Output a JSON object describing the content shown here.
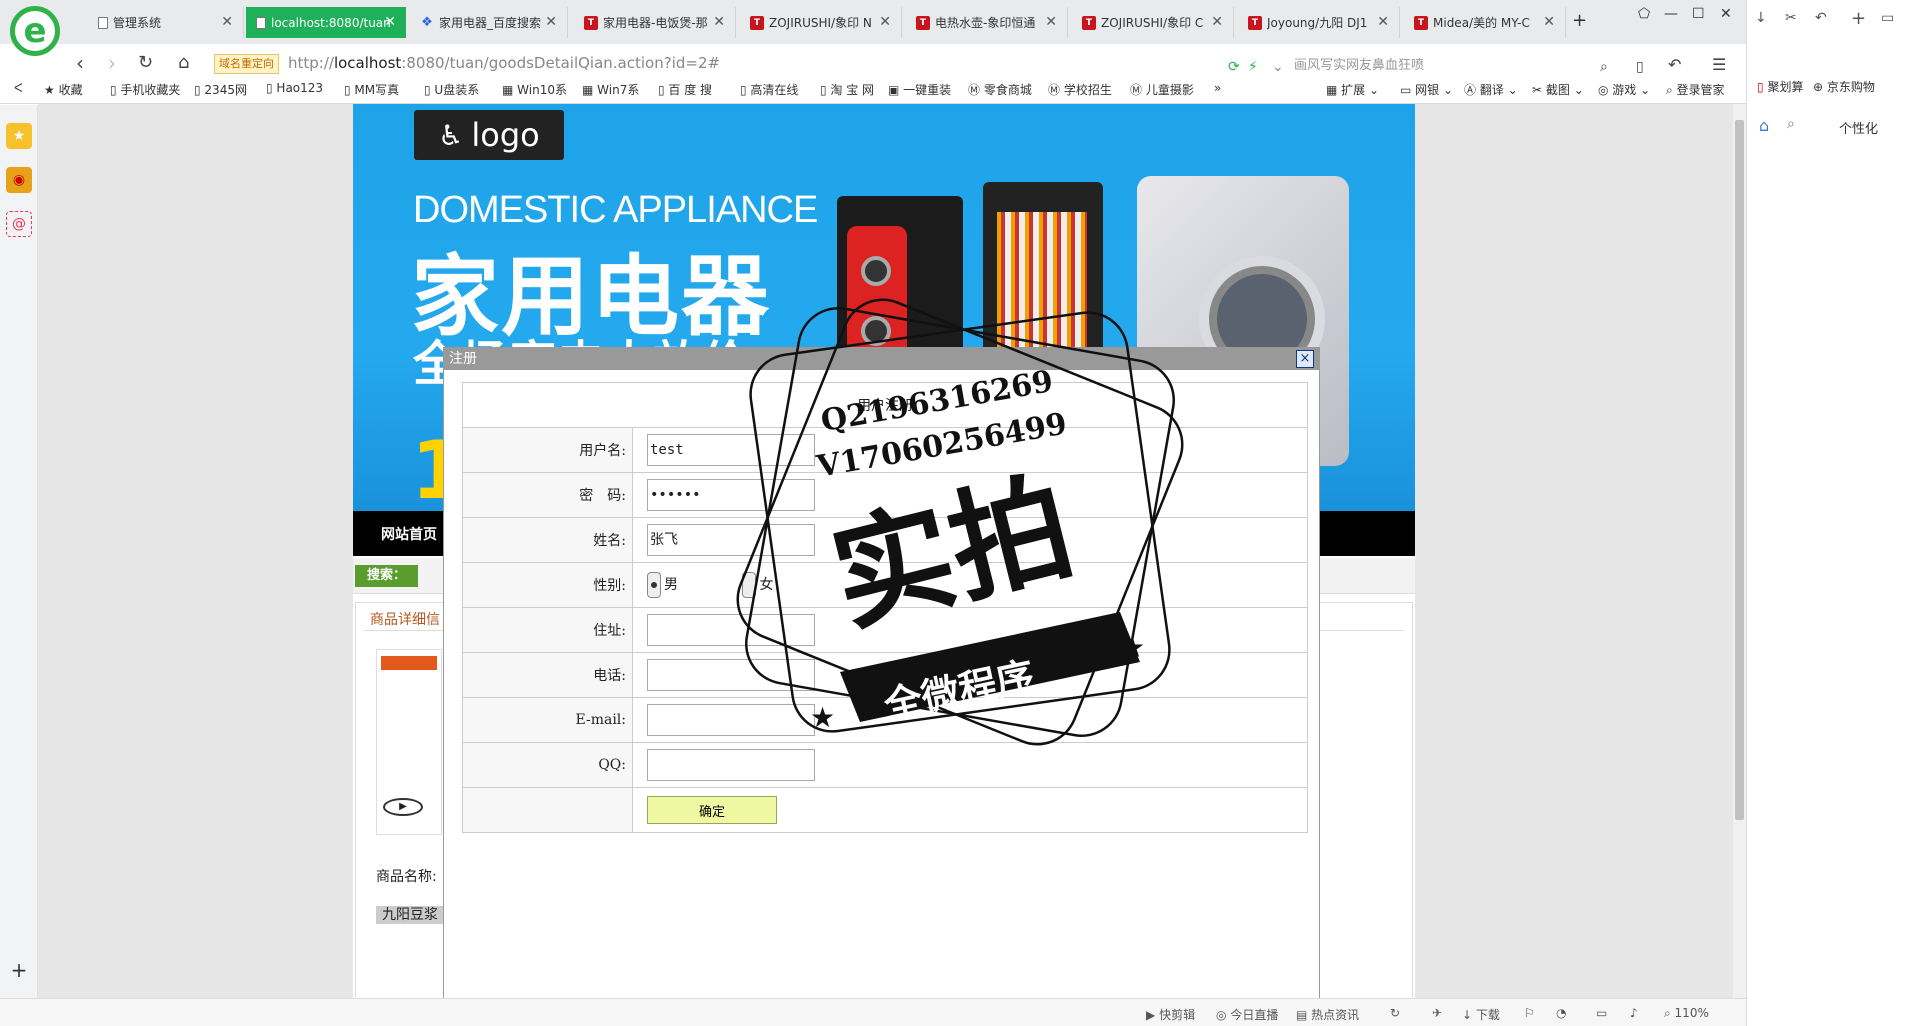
{
  "browser": {
    "tabs": [
      {
        "label": "管理系统",
        "icon": "doc",
        "active": false
      },
      {
        "label": "localhost:8080/tuan",
        "icon": "doc",
        "active": true
      },
      {
        "label": "家用电器_百度搜索",
        "icon": "paw",
        "active": false
      },
      {
        "label": "家用电器-电饭煲-那",
        "icon": "red",
        "active": false
      },
      {
        "label": "ZOJIRUSHI/象印 N",
        "icon": "red",
        "active": false
      },
      {
        "label": "电热水壶-象印恒通",
        "icon": "red",
        "active": false
      },
      {
        "label": "ZOJIRUSHI/象印 C",
        "icon": "red",
        "active": false
      },
      {
        "label": "Joyoung/九阳 DJ1",
        "icon": "red",
        "active": false
      },
      {
        "label": "Midea/美的 MY-C",
        "icon": "red",
        "active": false
      }
    ],
    "new_tab": "+",
    "redirect_badge": "域名重定向",
    "url_prefix": "http://",
    "url_host": "localhost",
    "url_rest": ":8080/tuan/goodsDetailQian.action?id=2#",
    "search_placeholder": "画风写实网友鼻血狂喷",
    "bookmarks": [
      "收藏",
      "手机收藏夹",
      "2345网",
      "Hao123",
      "MM写真",
      "U盘装系",
      "Win10系",
      "Win7系",
      "百 度 搜",
      "高清在线",
      "淘 宝 网",
      "一键重装",
      "零食商城",
      "学校招生",
      "儿童摄影"
    ],
    "bookmark_tools": [
      "扩展",
      "网银",
      "翻译",
      "截图",
      "游戏",
      "登录管家"
    ],
    "right_panel": {
      "items": [
        "聚划算",
        "京东购物"
      ],
      "personalize": "个性化"
    },
    "status": {
      "items": [
        "快剪辑",
        "今日直播",
        "热点资讯",
        "下载"
      ],
      "zoom": "110%"
    }
  },
  "site": {
    "logo_text": "logo",
    "banner_en": "DOMESTIC APPLIANCE",
    "banner_cn": "家用电器",
    "banner_sub": "全场家电大放价",
    "banner_num": "1",
    "menu_home": "网站首页",
    "search_label": "搜索：",
    "detail_heading": "商品详细信",
    "product_name_label": "商品名称:",
    "product_tag": "九阳豆浆"
  },
  "dialog": {
    "title": "注册",
    "close": "×",
    "form_title": "用户注册",
    "labels": {
      "username": "用户名:",
      "password": "密　码:",
      "name": "姓名:",
      "gender": "性别:",
      "address": "住址:",
      "phone": "电话:",
      "email": "E-mail:",
      "qq": "QQ:"
    },
    "values": {
      "username": "test",
      "password": "••••••",
      "name": "张飞",
      "address": "",
      "phone": "",
      "email": "",
      "qq": ""
    },
    "gender_options": [
      "男",
      "女"
    ],
    "gender_selected": "男",
    "submit_label": "确定"
  },
  "watermark": {
    "line1": "Q2196316269",
    "line2": "V17060256499",
    "big": "实拍",
    "ribbon": "全微程序"
  }
}
